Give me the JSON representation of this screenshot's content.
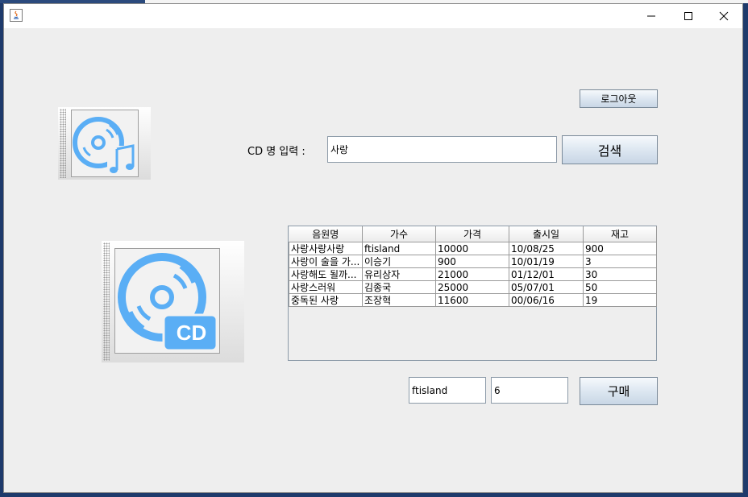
{
  "window": {
    "title": ""
  },
  "colors": {
    "accent": "#5aaef5",
    "button_gradient_bottom": "#c8d6e5"
  },
  "header": {
    "logout_label": "로그아웃",
    "search_label": "CD 명 입력 :",
    "search_value": "사랑",
    "search_button_label": "검색"
  },
  "images": {
    "music_icon": "music-cd-icon",
    "cd_icon": "cd-icon",
    "cd_badge_text": "CD"
  },
  "table": {
    "columns": [
      "음원명",
      "가수",
      "가격",
      "출시일",
      "재고"
    ],
    "rows": [
      [
        "사랑사랑사랑",
        "ftisland",
        "10000",
        "10/08/25",
        "900"
      ],
      [
        "사랑이 술을 가...",
        "이승기",
        "900",
        "10/01/19",
        "3"
      ],
      [
        "사랑해도 될까...",
        "유리상자",
        "21000",
        "01/12/01",
        "30"
      ],
      [
        "사랑스러워",
        "김종국",
        "25000",
        "05/07/01",
        "50"
      ],
      [
        "중독된 사랑",
        "조장혁",
        "11600",
        "00/06/16",
        "19"
      ]
    ]
  },
  "purchase": {
    "singer_value": "ftisland",
    "quantity_value": "6",
    "buy_button_label": "구매"
  }
}
